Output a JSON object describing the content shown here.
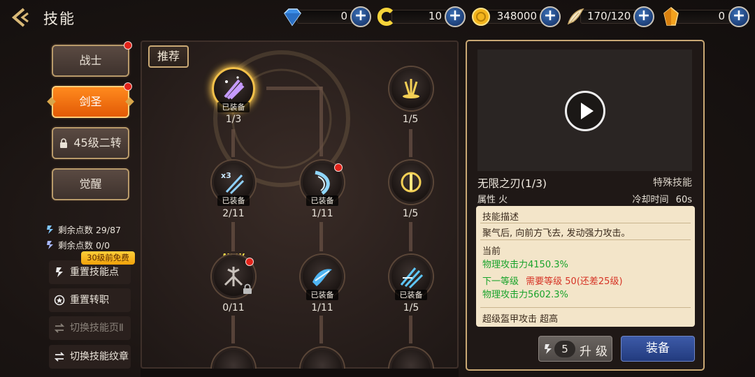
{
  "header": {
    "title": "技能"
  },
  "currencies": [
    {
      "icon": "blue-diamond-icon",
      "value": "0"
    },
    {
      "icon": "yellow-c-coin-icon",
      "value": "10"
    },
    {
      "icon": "gold-coin-icon",
      "value": "348000"
    },
    {
      "icon": "wing-feather-icon",
      "value": "170/120"
    },
    {
      "icon": "orange-crystal-icon",
      "value": "0"
    }
  ],
  "classes": [
    {
      "label": "战士",
      "active": false,
      "dot": true
    },
    {
      "label": "剑圣",
      "active": true,
      "dot": true
    },
    {
      "label": "45级二转",
      "locked": true
    },
    {
      "label": "觉醒"
    }
  ],
  "points": {
    "remaining": "剩余点数 29/87",
    "remaining2": "剩余点数 0/0"
  },
  "actions": {
    "free_badge": "30级前免费",
    "reset_points": "重置技能点",
    "reset_job": "重置转职",
    "switch_page": "切换技能页Ⅱ",
    "switch_glyph": "切换技能纹章"
  },
  "tree": {
    "recommend": "推荐",
    "new_label": "NEW",
    "skills": [
      {
        "name": "skill-infinite-blade",
        "tag": "已装备",
        "level": "1/3"
      },
      {
        "name": "skill-top-right",
        "tag": "",
        "level": "1/5"
      },
      {
        "name": "skill-x3-slash",
        "tag": "已装备",
        "level": "2/11"
      },
      {
        "name": "skill-crescent",
        "tag": "已装备",
        "level": "1/11"
      },
      {
        "name": "skill-golden-sword",
        "tag": "",
        "level": "1/5"
      },
      {
        "name": "skill-new-locked",
        "tag": "",
        "level": "0/11"
      },
      {
        "name": "skill-wave-strike",
        "tag": "已装备",
        "level": "1/11"
      },
      {
        "name": "skill-multi-sword",
        "tag": "已装备",
        "level": "1/5"
      }
    ]
  },
  "detail": {
    "name": "无限之刃(1/3)",
    "type": "特殊技能",
    "attr": "属性 火",
    "cooldown_label": "冷却时间",
    "cooldown_value": "60s",
    "desc_header": "技能描述",
    "desc": "聚气后, 向前方飞去, 发动强力攻击。",
    "current_header": "当前",
    "current_value": "物理攻击力4150.3%",
    "next_label": "下一等级",
    "next_req": "需要等级 50(还差25级)",
    "next_value": "物理攻击力5602.3%",
    "super_armor": "超级盔甲攻击  超高",
    "upgrade_cost": "5",
    "upgrade_label": "升级",
    "equip_label": "装备"
  }
}
